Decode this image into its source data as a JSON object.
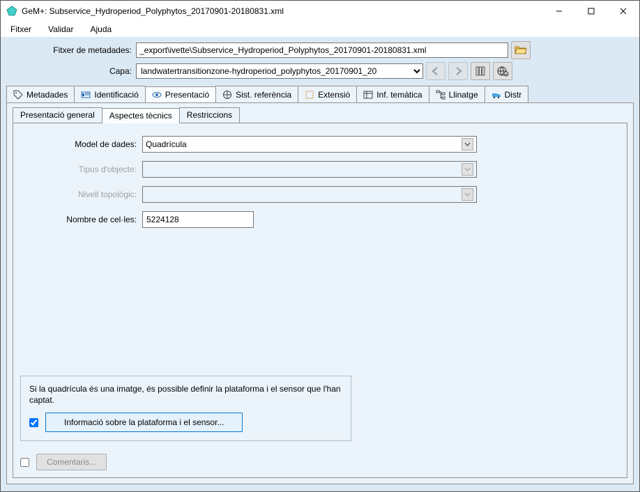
{
  "window": {
    "title": "GeM+: Subservice_Hydroperiod_Polyphytos_20170901-20180831.xml"
  },
  "menu": {
    "file": "Fitxer",
    "validate": "Validar",
    "help": "Ajuda"
  },
  "toolbar": {
    "metadata_file_label": "Fitxer de metadades:",
    "metadata_file_value": "_export\\ivette\\Subservice_Hydroperiod_Polyphytos_20170901-20180831.xml",
    "layer_label": "Capa:",
    "layer_value": "landwatertransitionzone-hydroperiod_polyphytos_20170901_20"
  },
  "main_tabs": {
    "metadata": "Metadades",
    "identification": "Identificació",
    "presentation": "Presentació",
    "ref_system": "Sist. referència",
    "extent": "Extensió",
    "thematic": "Inf. temàtica",
    "lineage": "Llinatge",
    "distribution": "Distr"
  },
  "sub_tabs": {
    "general": "Presentació general",
    "technical": "Aspectes tècnics",
    "restrictions": "Restriccions"
  },
  "form": {
    "data_model_label": "Model de dades:",
    "data_model_value": "Quadrícula",
    "object_type_label": "Tipus d'objecte:",
    "topology_level_label": "Nivell topològic:",
    "cell_count_label": "Nombre de cel·les:",
    "cell_count_value": "5224128",
    "sensor_note": "Si la quadrícula és una imatge, és possible definir la plataforma i el sensor que l'han captat.",
    "sensor_button": "Informació sobre la plataforma i el sensor...",
    "sensor_checked": true
  },
  "footer": {
    "comments_button": "Comentaris..."
  }
}
